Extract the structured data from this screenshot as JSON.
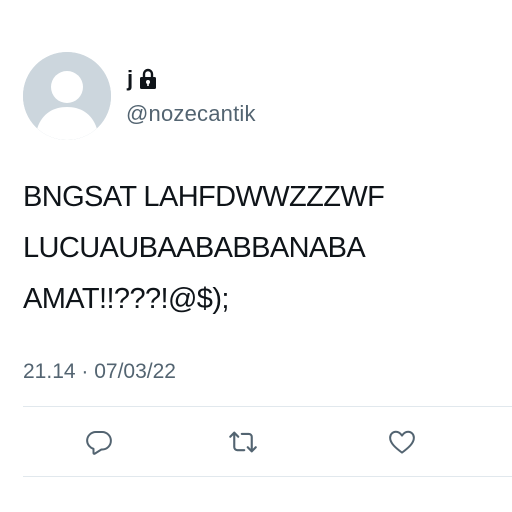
{
  "user": {
    "display_name": "j",
    "handle": "@nozecantik",
    "protected_icon": "lock-icon",
    "avatar_icon": "default-avatar-icon"
  },
  "tweet": {
    "text": "BNGSAT LAHFDWWZZZWF\nLUCUAUBAABABBANABA\nAMAT!!???!@$);",
    "timestamp": "21.14 · 07/03/22"
  },
  "actions": [
    {
      "name": "reply",
      "icon": "reply-icon"
    },
    {
      "name": "retweet",
      "icon": "retweet-icon"
    },
    {
      "name": "like",
      "icon": "heart-icon"
    }
  ],
  "colors": {
    "text": "#0f1419",
    "secondary": "#536471",
    "divider": "#e1e8ed",
    "avatar_bg": "#ccd6dd",
    "avatar_fg": "#ffffff"
  }
}
